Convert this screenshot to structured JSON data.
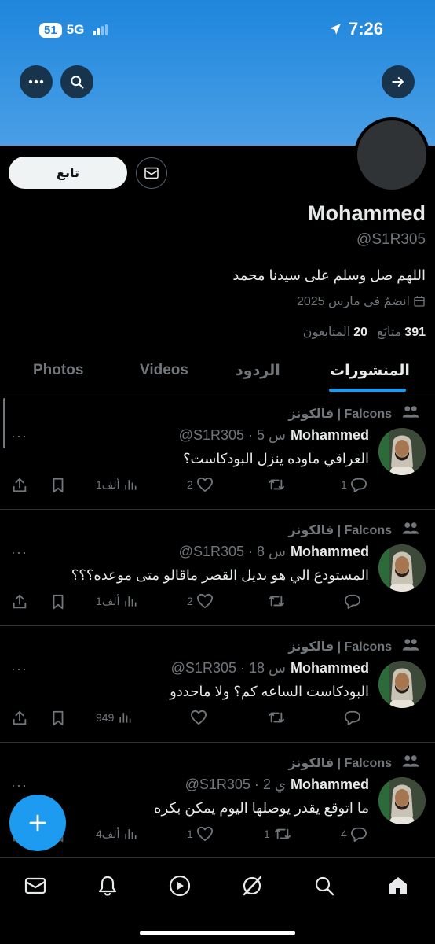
{
  "status_bar": {
    "signal_badge": "51",
    "network": "5G",
    "time": "7:26"
  },
  "profile": {
    "follow_label": "تابع",
    "name": "Mohammed",
    "handle": "@S1R305",
    "bio": "اللهم صل وسلم على سيدنا محمد",
    "joined": "انضمّ في مارس 2025",
    "following_count": "391",
    "following_label": "متابَع",
    "followers_count": "20",
    "followers_label": "المتابعون"
  },
  "tabs": [
    {
      "label": "المنشورات",
      "active": true
    },
    {
      "label": "الردود",
      "active": false
    },
    {
      "label": "Videos",
      "active": false
    },
    {
      "label": "Photos",
      "active": false
    }
  ],
  "posts": [
    {
      "community": "فالكونز | Falcons",
      "name": "Mohammed",
      "meta": "@S1R305 · 5 س",
      "text": "العراقي ماوده ينزل البودكاست؟",
      "replies": "1",
      "reposts": "",
      "likes": "2",
      "views": "1ألف"
    },
    {
      "community": "فالكونز | Falcons",
      "name": "Mohammed",
      "meta": "@S1R305 · 8 س",
      "text": "المستودع الي هو بديل القصر ماقالو متى موعده؟؟؟",
      "replies": "",
      "reposts": "",
      "likes": "2",
      "views": "1ألف"
    },
    {
      "community": "فالكونز | Falcons",
      "name": "Mohammed",
      "meta": "@S1R305 · 18 س",
      "text": "البودكاست الساعه كم؟ ولا ماحددو",
      "replies": "",
      "reposts": "",
      "likes": "",
      "views": "949"
    },
    {
      "community": "فالكونز | Falcons",
      "name": "Mohammed",
      "meta": "@S1R305 · 2 ي",
      "text": "ما اتوقع يقدر يوصلها اليوم يمكن بكره",
      "replies": "4",
      "reposts": "1",
      "likes": "1",
      "views": "4ألف"
    }
  ],
  "icons": {
    "more": "more-horizontal-icon",
    "search": "search-icon",
    "forward": "arrow-right-icon",
    "message": "envelope-icon",
    "compose": "plus-icon",
    "nav": [
      "envelope-icon",
      "bell-icon",
      "play-icon",
      "grok-icon",
      "search-icon",
      "home-icon"
    ]
  },
  "colors": {
    "accent": "#1d9bf0",
    "banner": "#1e86dc",
    "background": "#000000"
  }
}
